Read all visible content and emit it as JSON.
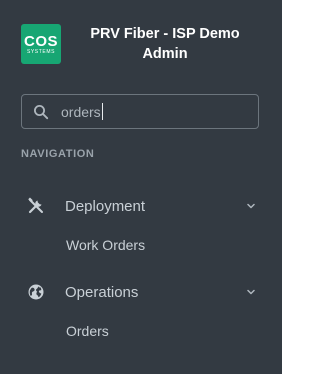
{
  "brand": {
    "logo_text": "COS",
    "logo_subtext": "SYSTEMS",
    "title": "PRV Fiber - ISP Demo Admin",
    "logo_color": "#17a673"
  },
  "search": {
    "value": "orders",
    "icon": "search-icon"
  },
  "navigation": {
    "header": "NAVIGATION",
    "items": [
      {
        "label": "Deployment",
        "icon": "tools-icon",
        "expanded": true,
        "children": [
          {
            "label": "Work Orders"
          }
        ]
      },
      {
        "label": "Operations",
        "icon": "globe-icon",
        "expanded": true,
        "children": [
          {
            "label": "Orders"
          }
        ]
      }
    ]
  },
  "colors": {
    "sidebar_bg": "#333a42",
    "text": "#c9d0d6",
    "header_text": "#9aa3ab"
  }
}
